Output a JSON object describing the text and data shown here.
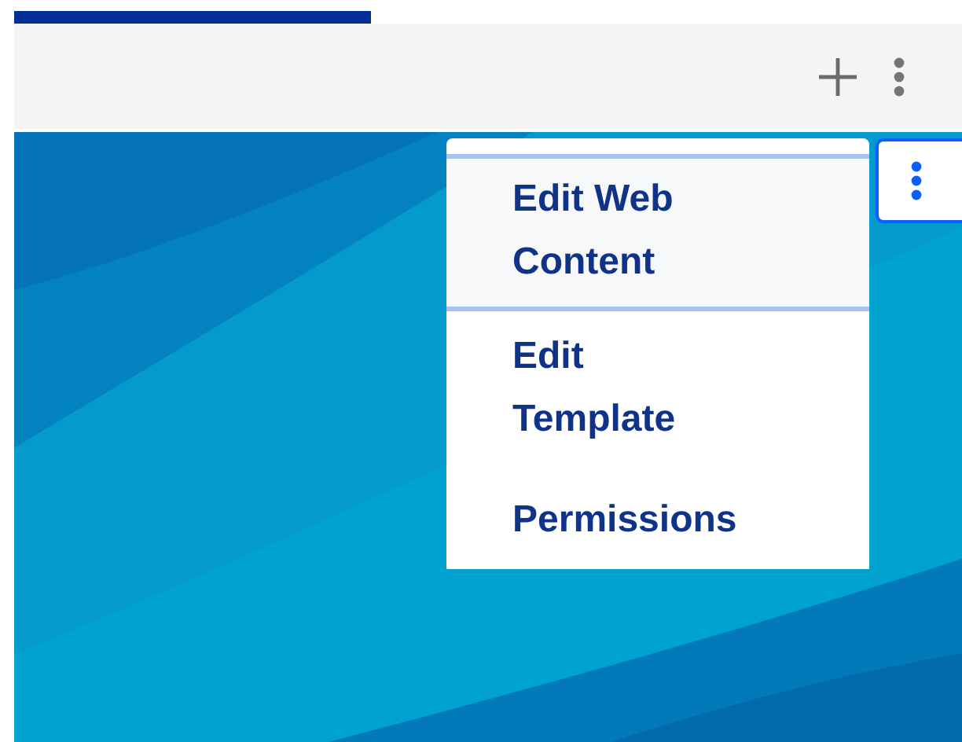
{
  "menu": {
    "items": [
      {
        "label": "Edit Web Content",
        "selected": true
      },
      {
        "label": "Edit Template",
        "selected": false
      },
      {
        "label": "Permissions",
        "selected": false
      }
    ]
  }
}
